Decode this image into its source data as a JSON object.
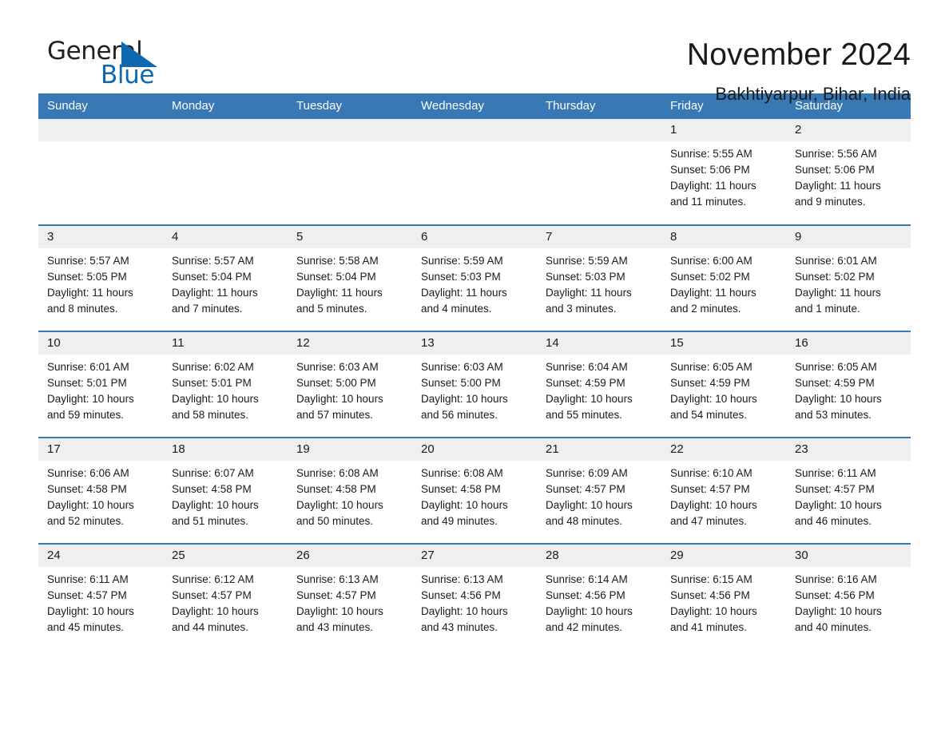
{
  "brand": {
    "word_general": "General",
    "word_blue": "Blue",
    "flag_icon": "triangle-flag-icon",
    "accent_color": "#1069b0"
  },
  "header": {
    "month_title": "November 2024",
    "location": "Bakhtiyarpur, Bihar, India"
  },
  "calendar": {
    "header_color": "#3878b4",
    "daynum_bg": "#efefef",
    "weekday_headers": [
      "Sunday",
      "Monday",
      "Tuesday",
      "Wednesday",
      "Thursday",
      "Friday",
      "Saturday"
    ],
    "weeks": [
      [
        {
          "day": "",
          "blank": true
        },
        {
          "day": "",
          "blank": true
        },
        {
          "day": "",
          "blank": true
        },
        {
          "day": "",
          "blank": true
        },
        {
          "day": "",
          "blank": true
        },
        {
          "day": "1",
          "sunrise": "Sunrise: 5:55 AM",
          "sunset": "Sunset: 5:06 PM",
          "daylight_line1": "Daylight: 11 hours",
          "daylight_line2": "and 11 minutes."
        },
        {
          "day": "2",
          "sunrise": "Sunrise: 5:56 AM",
          "sunset": "Sunset: 5:06 PM",
          "daylight_line1": "Daylight: 11 hours",
          "daylight_line2": "and 9 minutes."
        }
      ],
      [
        {
          "day": "3",
          "sunrise": "Sunrise: 5:57 AM",
          "sunset": "Sunset: 5:05 PM",
          "daylight_line1": "Daylight: 11 hours",
          "daylight_line2": "and 8 minutes."
        },
        {
          "day": "4",
          "sunrise": "Sunrise: 5:57 AM",
          "sunset": "Sunset: 5:04 PM",
          "daylight_line1": "Daylight: 11 hours",
          "daylight_line2": "and 7 minutes."
        },
        {
          "day": "5",
          "sunrise": "Sunrise: 5:58 AM",
          "sunset": "Sunset: 5:04 PM",
          "daylight_line1": "Daylight: 11 hours",
          "daylight_line2": "and 5 minutes."
        },
        {
          "day": "6",
          "sunrise": "Sunrise: 5:59 AM",
          "sunset": "Sunset: 5:03 PM",
          "daylight_line1": "Daylight: 11 hours",
          "daylight_line2": "and 4 minutes."
        },
        {
          "day": "7",
          "sunrise": "Sunrise: 5:59 AM",
          "sunset": "Sunset: 5:03 PM",
          "daylight_line1": "Daylight: 11 hours",
          "daylight_line2": "and 3 minutes."
        },
        {
          "day": "8",
          "sunrise": "Sunrise: 6:00 AM",
          "sunset": "Sunset: 5:02 PM",
          "daylight_line1": "Daylight: 11 hours",
          "daylight_line2": "and 2 minutes."
        },
        {
          "day": "9",
          "sunrise": "Sunrise: 6:01 AM",
          "sunset": "Sunset: 5:02 PM",
          "daylight_line1": "Daylight: 11 hours",
          "daylight_line2": "and 1 minute."
        }
      ],
      [
        {
          "day": "10",
          "sunrise": "Sunrise: 6:01 AM",
          "sunset": "Sunset: 5:01 PM",
          "daylight_line1": "Daylight: 10 hours",
          "daylight_line2": "and 59 minutes."
        },
        {
          "day": "11",
          "sunrise": "Sunrise: 6:02 AM",
          "sunset": "Sunset: 5:01 PM",
          "daylight_line1": "Daylight: 10 hours",
          "daylight_line2": "and 58 minutes."
        },
        {
          "day": "12",
          "sunrise": "Sunrise: 6:03 AM",
          "sunset": "Sunset: 5:00 PM",
          "daylight_line1": "Daylight: 10 hours",
          "daylight_line2": "and 57 minutes."
        },
        {
          "day": "13",
          "sunrise": "Sunrise: 6:03 AM",
          "sunset": "Sunset: 5:00 PM",
          "daylight_line1": "Daylight: 10 hours",
          "daylight_line2": "and 56 minutes."
        },
        {
          "day": "14",
          "sunrise": "Sunrise: 6:04 AM",
          "sunset": "Sunset: 4:59 PM",
          "daylight_line1": "Daylight: 10 hours",
          "daylight_line2": "and 55 minutes."
        },
        {
          "day": "15",
          "sunrise": "Sunrise: 6:05 AM",
          "sunset": "Sunset: 4:59 PM",
          "daylight_line1": "Daylight: 10 hours",
          "daylight_line2": "and 54 minutes."
        },
        {
          "day": "16",
          "sunrise": "Sunrise: 6:05 AM",
          "sunset": "Sunset: 4:59 PM",
          "daylight_line1": "Daylight: 10 hours",
          "daylight_line2": "and 53 minutes."
        }
      ],
      [
        {
          "day": "17",
          "sunrise": "Sunrise: 6:06 AM",
          "sunset": "Sunset: 4:58 PM",
          "daylight_line1": "Daylight: 10 hours",
          "daylight_line2": "and 52 minutes."
        },
        {
          "day": "18",
          "sunrise": "Sunrise: 6:07 AM",
          "sunset": "Sunset: 4:58 PM",
          "daylight_line1": "Daylight: 10 hours",
          "daylight_line2": "and 51 minutes."
        },
        {
          "day": "19",
          "sunrise": "Sunrise: 6:08 AM",
          "sunset": "Sunset: 4:58 PM",
          "daylight_line1": "Daylight: 10 hours",
          "daylight_line2": "and 50 minutes."
        },
        {
          "day": "20",
          "sunrise": "Sunrise: 6:08 AM",
          "sunset": "Sunset: 4:58 PM",
          "daylight_line1": "Daylight: 10 hours",
          "daylight_line2": "and 49 minutes."
        },
        {
          "day": "21",
          "sunrise": "Sunrise: 6:09 AM",
          "sunset": "Sunset: 4:57 PM",
          "daylight_line1": "Daylight: 10 hours",
          "daylight_line2": "and 48 minutes."
        },
        {
          "day": "22",
          "sunrise": "Sunrise: 6:10 AM",
          "sunset": "Sunset: 4:57 PM",
          "daylight_line1": "Daylight: 10 hours",
          "daylight_line2": "and 47 minutes."
        },
        {
          "day": "23",
          "sunrise": "Sunrise: 6:11 AM",
          "sunset": "Sunset: 4:57 PM",
          "daylight_line1": "Daylight: 10 hours",
          "daylight_line2": "and 46 minutes."
        }
      ],
      [
        {
          "day": "24",
          "sunrise": "Sunrise: 6:11 AM",
          "sunset": "Sunset: 4:57 PM",
          "daylight_line1": "Daylight: 10 hours",
          "daylight_line2": "and 45 minutes."
        },
        {
          "day": "25",
          "sunrise": "Sunrise: 6:12 AM",
          "sunset": "Sunset: 4:57 PM",
          "daylight_line1": "Daylight: 10 hours",
          "daylight_line2": "and 44 minutes."
        },
        {
          "day": "26",
          "sunrise": "Sunrise: 6:13 AM",
          "sunset": "Sunset: 4:57 PM",
          "daylight_line1": "Daylight: 10 hours",
          "daylight_line2": "and 43 minutes."
        },
        {
          "day": "27",
          "sunrise": "Sunrise: 6:13 AM",
          "sunset": "Sunset: 4:56 PM",
          "daylight_line1": "Daylight: 10 hours",
          "daylight_line2": "and 43 minutes."
        },
        {
          "day": "28",
          "sunrise": "Sunrise: 6:14 AM",
          "sunset": "Sunset: 4:56 PM",
          "daylight_line1": "Daylight: 10 hours",
          "daylight_line2": "and 42 minutes."
        },
        {
          "day": "29",
          "sunrise": "Sunrise: 6:15 AM",
          "sunset": "Sunset: 4:56 PM",
          "daylight_line1": "Daylight: 10 hours",
          "daylight_line2": "and 41 minutes."
        },
        {
          "day": "30",
          "sunrise": "Sunrise: 6:16 AM",
          "sunset": "Sunset: 4:56 PM",
          "daylight_line1": "Daylight: 10 hours",
          "daylight_line2": "and 40 minutes."
        }
      ]
    ]
  }
}
